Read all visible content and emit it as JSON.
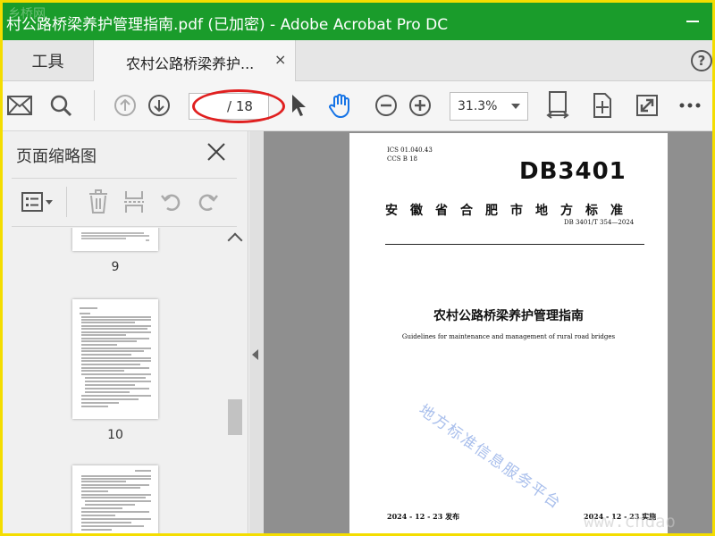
{
  "window": {
    "title": "村公路桥梁养护管理指南.pdf  (已加密) - Adobe Acrobat Pro DC",
    "watermark_logo": "乡桥网"
  },
  "tabs": {
    "tools_label": "工具",
    "doc_label": "农村公路桥梁养护...",
    "close_glyph": "×"
  },
  "toolbar": {
    "page_current": "",
    "page_total": "/ 18",
    "zoom": "31.3%",
    "icons": [
      "mail-icon",
      "search-icon",
      "page-up-icon",
      "page-down-icon",
      "select-cursor-icon",
      "hand-tool-icon",
      "zoom-out-icon",
      "zoom-in-icon",
      "fit-page-icon",
      "rotate-page-icon",
      "fullscreen-icon",
      "more-icon"
    ]
  },
  "sidepane": {
    "title": "页面缩略图",
    "thumbnails": [
      {
        "label": "9"
      },
      {
        "label": "10"
      },
      {
        "label": ""
      }
    ]
  },
  "document": {
    "ics": "ICS  01.040.43",
    "ccs": "CCS  B 18",
    "db": "DB3401",
    "issuer": "安徽省合肥市地方标准",
    "code": "DB 3401/T 354—2024",
    "title": "农村公路桥梁养护管理指南",
    "subtitle": "Guidelines for maintenance and management of rural road bridges",
    "watermark": "地方标准信息服务平台",
    "published": "2024 - 12 - 23 发布",
    "implemented": "2024 - 12 - 23 实施"
  },
  "corner_watermark": "www.chdao",
  "colors": {
    "titlebar": "#1a9c2b",
    "frame": "#f4dd00",
    "highlight_oval": "#e02020",
    "hand_tool": "#1473e6"
  }
}
